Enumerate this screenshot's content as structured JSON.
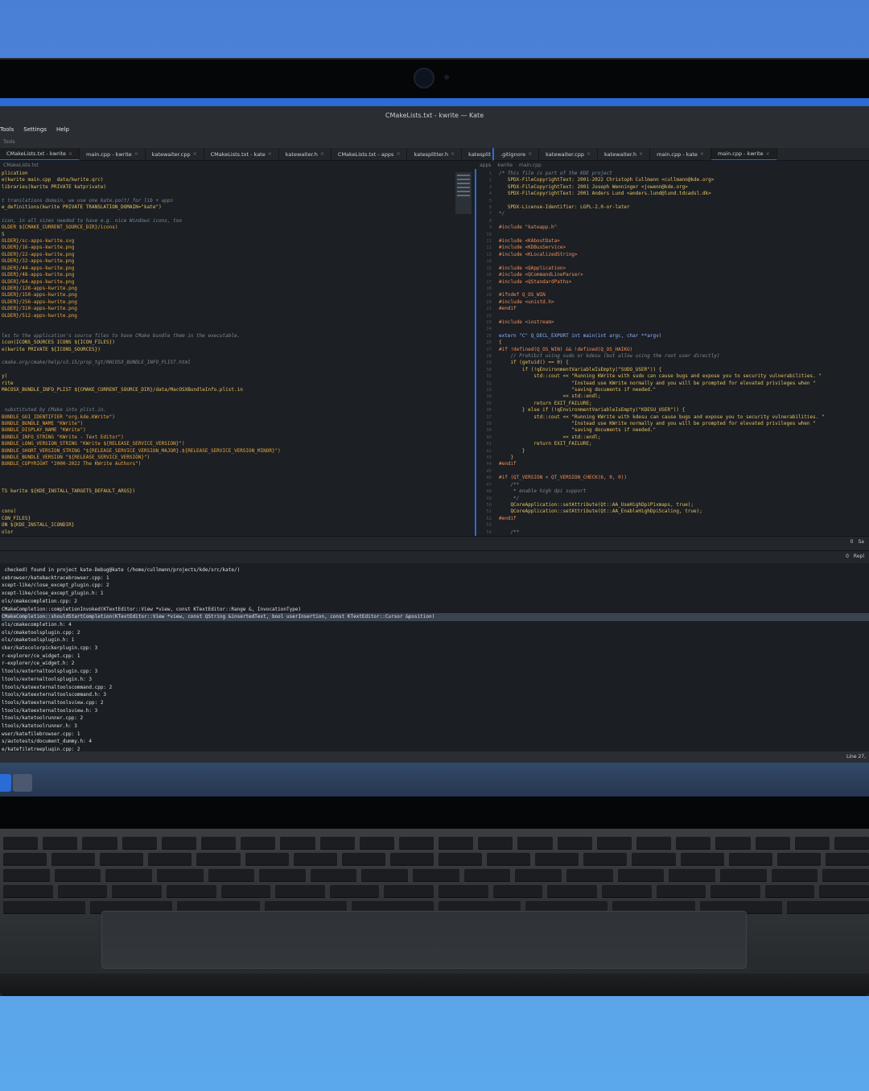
{
  "window": {
    "title": "CMakeLists.txt - kwrite — Kate"
  },
  "menu": {
    "items": [
      "Tools",
      "Settings",
      "Help"
    ]
  },
  "toolbar": {
    "hint": "Tools"
  },
  "left_tabs": [
    "CMakeLists.txt - kwrite",
    "main.cpp - kwrite",
    "katewaiter.cpp",
    "CMakeLists.txt - kate",
    "katewaiter.h",
    "CMakeLists.txt - apps",
    "katesplitter.h",
    "katesplit"
  ],
  "right_tabs": [
    ".gitignore",
    "katewaiter.cpp",
    "katewaiter.h",
    "main.cpp - kate",
    "main.cpp - kwrite"
  ],
  "left_breadcrumb": "CMakeLists.txt",
  "right_breadcrumb": [
    "apps",
    "kwrite",
    "main.cpp"
  ],
  "left_code": [
    "plication",
    "e(kwrite main.cpp  data/kwrite.qrc)",
    "libraries(kwrite PRIVATE katprivate)",
    "",
    "t translations domain, we use one kate.po(t) for lib + apps",
    "e_definitions(kwrite PRIVATE TRANSLATION_DOMAIN=\"kate\")",
    "",
    "icon, in all sizes needed to have e.g. nice Windows icons, too",
    "OLDER ${CMAKE_CURRENT_SOURCE_DIR}/icons)",
    "S",
    "OLDER}/sc-apps-kwrite.svg",
    "OLDER}/16-apps-kwrite.png",
    "OLDER}/22-apps-kwrite.png",
    "OLDER}/32-apps-kwrite.png",
    "OLDER}/44-apps-kwrite.png",
    "OLDER}/48-apps-kwrite.png",
    "OLDER}/64-apps-kwrite.png",
    "OLDER}/128-apps-kwrite.png",
    "OLDER}/150-apps-kwrite.png",
    "OLDER}/256-apps-kwrite.png",
    "OLDER}/310-apps-kwrite.png",
    "OLDER}/512-apps-kwrite.png",
    "",
    "",
    "les to the application's source files to have CMake bundle them in the executable.",
    "icon(ICONS_SOURCES ICONS ${ICON_FILES})",
    "e(kwrite PRIVATE ${ICONS_SOURCES})",
    "",
    "cmake.org/cmake/help/v3.15/prop_tgt/MACOSX_BUNDLE_INFO_PLIST.html",
    "",
    "y(",
    "rite",
    "MACOSX_BUNDLE_INFO_PLIST ${CMAKE_CURRENT_SOURCE_DIR}/data/MacOSXBundleInfo.plist.in",
    "",
    "",
    " substituted by CMake into plist.in.",
    "BUNDLE_GUI_IDENTIFIER \"org.kde.KWrite\")",
    "BUNDLE_BUNDLE_NAME \"KWrite\")",
    "BUNDLE_DISPLAY_NAME \"KWrite\")",
    "BUNDLE_INFO_STRING \"KWrite - Text Editor\")",
    "BUNDLE_LONG_VERSION_STRING \"KWrite ${RELEASE_SERVICE_VERSION}\")",
    "BUNDLE_SHORT_VERSION_STRING \"${RELEASE_SERVICE_VERSION_MAJOR}.${RELEASE_SERVICE_VERSION_MINOR}\")",
    "BUNDLE_BUNDLE_VERSION \"${RELEASE_SERVICE_VERSION}\")",
    "BUNDLE_COPYRIGHT \"2000-2022 The KWrite Authors\")",
    "",
    "",
    "",
    "TS kwrite ${KDE_INSTALL_TARGETS_DEFAULT_ARGS})",
    "",
    "",
    "cons(",
    "CON_FILES}",
    "ON ${KDE_INSTALL_ICONDIR}",
    "olor"
  ],
  "right_code": [
    "/* This file is part of the KDE project",
    "   SPDX-FileCopyrightText: 2001-2022 Christoph Cullmann <cullmann@kde.org>",
    "   SPDX-FileCopyrightText: 2001 Joseph Wenninger <jowenn@kde.org>",
    "   SPDX-FileCopyrightText: 2001 Anders Lund <anders.lund@lund.tdcadsl.dk>",
    "",
    "   SPDX-License-Identifier: LGPL-2.0-or-later",
    "*/",
    "",
    "#include \"kateapp.h\"",
    "",
    "#include <KAboutData>",
    "#include <KDBusService>",
    "#include <KLocalizedString>",
    "",
    "#include <QApplication>",
    "#include <QCommandLineParser>",
    "#include <QStandardPaths>",
    "",
    "#ifndef Q_OS_WIN",
    "#include <unistd.h>",
    "#endif",
    "",
    "#include <iostream>",
    "",
    "extern \"C\" Q_DECL_EXPORT int main(int argc, char **argv)",
    "{",
    "#if !defined(Q_OS_WIN) && !defined(Q_OS_HAIKU)",
    "    // Prohibit using sudo or kdesu (but allow using the root user directly)",
    "    if (getuid() == 0) {",
    "        if (!qEnvironmentVariableIsEmpty(\"SUDO_USER\")) {",
    "            std::cout << \"Running KWrite with sudo can cause bugs and expose you to security vulnerabilities. \"",
    "                         \"Instead use KWrite normally and you will be prompted for elevated privileges when \"",
    "                         \"saving documents if needed.\"",
    "                      << std::endl;",
    "            return EXIT_FAILURE;",
    "        } else if (!qEnvironmentVariableIsEmpty(\"KDESU_USER\")) {",
    "            std::cout << \"Running KWrite with kdesu can cause bugs and expose you to security vulnerabilities. \"",
    "                         \"Instead use KWrite normally and you will be prompted for elevated privileges when \"",
    "                         \"saving documents if needed.\"",
    "                      << std::endl;",
    "            return EXIT_FAILURE;",
    "        }",
    "    }",
    "#endif",
    "",
    "#if (QT_VERSION < QT_VERSION_CHECK(6, 0, 0))",
    "    /**",
    "     * enable high dpi support",
    "     */",
    "    QCoreApplication::setAttribute(Qt::AA_UseHighDpiPixmaps, true);",
    "    QCoreApplication::setAttribute(Qt::AA_EnableHighDpiScaling, true);",
    "#endif",
    "",
    "    /**",
    "     * allow fractional scaling"
  ],
  "split_status": {
    "left": "0",
    "right": "Sa"
  },
  "split_status2": {
    "left": "0",
    "right": "Repl"
  },
  "search_results": [
    " checked) found in project kate-Debug@kate (/home/cullmann/projects/kde/src/kate/)",
    "cebrowser/katebacktracebrowser.cpp: 1",
    "xcept-like/close_except_plugin.cpp: 2",
    "xcept-like/close_except_plugin.h: 1",
    "ols/cmakecompletion.cpp: 2",
    "CMakeCompletion::completionInvoked(KTextEditor::View *view, const KTextEditor::Range &, InvocationType)",
    "CMakeCompletion::shouldStartCompletion(KTextEditor::View *view, const QString &insertedText, bool userInsertion, const KTextEditor::Cursor &position)",
    "ols/cmakecompletion.h: 4",
    "ols/cmaketoolsplugin.cpp: 2",
    "ols/cmaketoolsplugin.h: 1",
    "cker/katecolorpickerplugin.cpp: 3",
    "r-explorer/ce_widget.cpp: 1",
    "r-explorer/ce_widget.h: 2",
    "ltools/externaltoolsplugin.cpp: 3",
    "ltools/externaltoolsplugin.h: 3",
    "ltools/kateexternaltoolscommand.cpp: 2",
    "ltools/kateexternaltoolscommand.h: 3",
    "ltools/kateexternaltoolsview.cpp: 2",
    "ltools/kateexternaltoolsview.h: 3",
    "ltools/katetoolrunner.cpp: 2",
    "ltools/katetoolrunner.h: 3",
    "wser/katefilebrowser.cpp: 1",
    "s/autotests/document_dummy.h: 4",
    "e/katefiletreeplugin.cpp: 2"
  ],
  "statusbar": {
    "right": "Line 27,"
  }
}
